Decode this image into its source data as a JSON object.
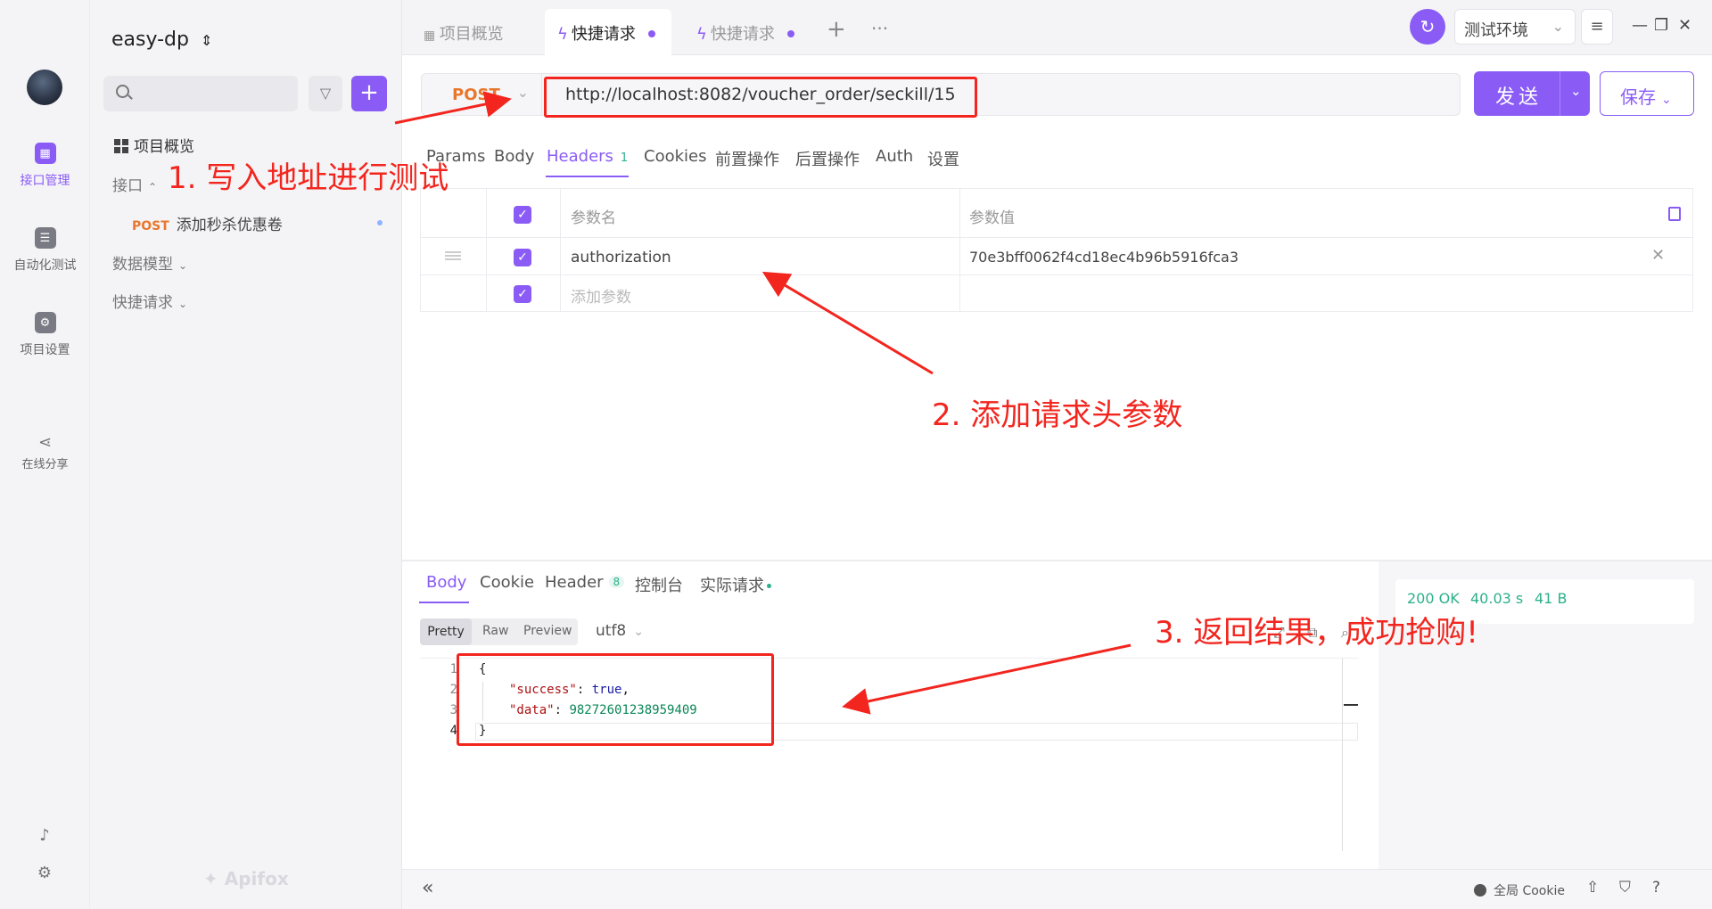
{
  "rail": {
    "items": [
      {
        "label": "接口管理",
        "icon": "api-icon"
      },
      {
        "label": "自动化测试",
        "icon": "automation-icon"
      },
      {
        "label": "项目设置",
        "icon": "settings-icon"
      },
      {
        "label": "在线分享",
        "icon": "share-icon"
      }
    ]
  },
  "tree": {
    "project_name": "easy-dp",
    "overview": "项目概览",
    "interfaces": "接口",
    "endpoint_method": "POST",
    "endpoint_name": "添加秒杀优惠卷",
    "data_models": "数据模型",
    "quick_requests": "快捷请求",
    "brand": "Apifox"
  },
  "tabs": [
    {
      "label": "项目概览"
    },
    {
      "label": "快捷请求"
    },
    {
      "label": "快捷请求"
    }
  ],
  "env": {
    "label": "测试环境"
  },
  "request": {
    "method": "POST",
    "url": "http://localhost:8082/voucher_order/seckill/15",
    "send_label": "发送",
    "save_label": "保存",
    "tabs": [
      "Params",
      "Body",
      "Headers",
      "Cookies",
      "前置操作",
      "后置操作",
      "Auth",
      "设置"
    ],
    "headers_count": "1",
    "columns": {
      "name": "参数名",
      "value": "参数值"
    },
    "header_rows": [
      {
        "name": "authorization",
        "value": "70e3bff0062f4cd18ec4b96b5916fca3"
      }
    ],
    "add_param_placeholder": "添加参数"
  },
  "response": {
    "tabs": [
      "Body",
      "Cookie",
      "Header",
      "控制台",
      "实际请求"
    ],
    "header_count": "8",
    "views": [
      "Pretty",
      "Raw",
      "Preview"
    ],
    "encoding": "utf8",
    "code_lines": [
      {
        "no": "1",
        "text": "{"
      },
      {
        "no": "2",
        "key": "\"success\"",
        "value": "true"
      },
      {
        "no": "3",
        "key": "\"data\"",
        "value": "98272601238959409"
      },
      {
        "no": "4",
        "text": "}"
      }
    ],
    "status": {
      "code": "200 OK",
      "time": "40.03 s",
      "size": "41 B"
    }
  },
  "footer": {
    "cookie": "全局 Cookie"
  },
  "annotations": {
    "step1": "1. 写入地址进行测试",
    "step2": "2. 添加请求头参数",
    "step3": "3. 返回结果，成功抢购!"
  },
  "colors": {
    "accent": "#8a5cf5",
    "annotation": "#f2261f",
    "post": "#e8772e",
    "success": "#2bb08a"
  }
}
